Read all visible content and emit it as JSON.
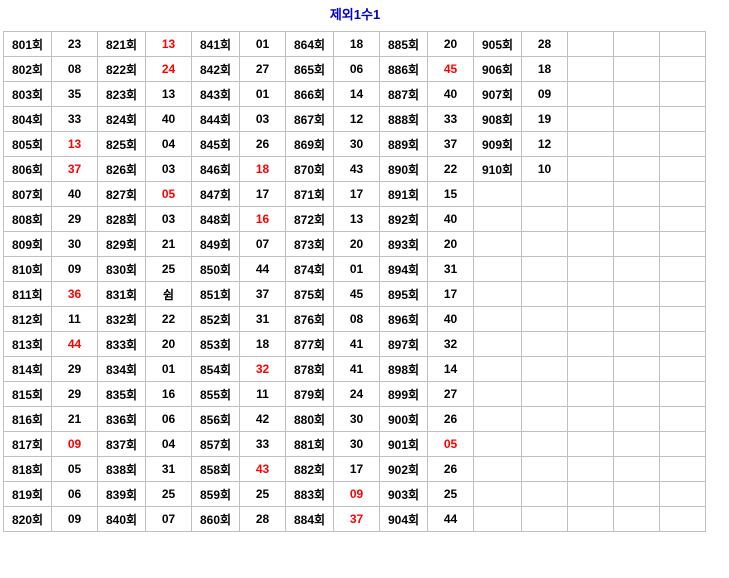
{
  "title": "제외1수1",
  "colors": {
    "title_blue": "#0000CC",
    "highlight_red": "#FF0000",
    "text_black": "#000000",
    "grid_line": "#C0C0C0",
    "background": "#FFFFFF"
  },
  "table": {
    "num_rows": 20,
    "empty_columns": 3,
    "groups": [
      {
        "rows": [
          {
            "label": "801회",
            "value": "23"
          },
          {
            "label": "802회",
            "value": "08"
          },
          {
            "label": "803회",
            "value": "35"
          },
          {
            "label": "804회",
            "value": "33"
          },
          {
            "label": "805회",
            "value": "13",
            "red": true
          },
          {
            "label": "806회",
            "value": "37",
            "red": true
          },
          {
            "label": "807회",
            "value": "40"
          },
          {
            "label": "808회",
            "value": "29"
          },
          {
            "label": "809회",
            "value": "30"
          },
          {
            "label": "810회",
            "value": "09"
          },
          {
            "label": "811회",
            "value": "36",
            "red": true
          },
          {
            "label": "812회",
            "value": "11"
          },
          {
            "label": "813회",
            "value": "44",
            "red": true
          },
          {
            "label": "814회",
            "value": "29"
          },
          {
            "label": "815회",
            "value": "29"
          },
          {
            "label": "816회",
            "value": "21"
          },
          {
            "label": "817회",
            "value": "09",
            "red": true
          },
          {
            "label": "818회",
            "value": "05"
          },
          {
            "label": "819회",
            "value": "06"
          },
          {
            "label": "820회",
            "value": "09"
          }
        ]
      },
      {
        "rows": [
          {
            "label": "821회",
            "value": "13",
            "red": true
          },
          {
            "label": "822회",
            "value": "24",
            "red": true
          },
          {
            "label": "823회",
            "value": "13"
          },
          {
            "label": "824회",
            "value": "40"
          },
          {
            "label": "825회",
            "value": "04"
          },
          {
            "label": "826회",
            "value": "03"
          },
          {
            "label": "827회",
            "value": "05",
            "red": true
          },
          {
            "label": "828회",
            "value": "03"
          },
          {
            "label": "829회",
            "value": "21"
          },
          {
            "label": "830회",
            "value": "25"
          },
          {
            "label": "831회",
            "value": "쉼"
          },
          {
            "label": "832회",
            "value": "22"
          },
          {
            "label": "833회",
            "value": "20"
          },
          {
            "label": "834회",
            "value": "01"
          },
          {
            "label": "835회",
            "value": "16"
          },
          {
            "label": "836회",
            "value": "06"
          },
          {
            "label": "837회",
            "value": "04"
          },
          {
            "label": "838회",
            "value": "31"
          },
          {
            "label": "839회",
            "value": "25"
          },
          {
            "label": "840회",
            "value": "07"
          }
        ]
      },
      {
        "rows": [
          {
            "label": "841회",
            "value": "01"
          },
          {
            "label": "842회",
            "value": "27"
          },
          {
            "label": "843회",
            "value": "01"
          },
          {
            "label": "844회",
            "value": "03"
          },
          {
            "label": "845회",
            "value": "26"
          },
          {
            "label": "846회",
            "value": "18",
            "red": true
          },
          {
            "label": "847회",
            "value": "17"
          },
          {
            "label": "848회",
            "value": "16",
            "red": true
          },
          {
            "label": "849회",
            "value": "07"
          },
          {
            "label": "850회",
            "value": "44"
          },
          {
            "label": "851회",
            "value": "37"
          },
          {
            "label": "852회",
            "value": "31"
          },
          {
            "label": "853회",
            "value": "18"
          },
          {
            "label": "854회",
            "value": "32",
            "red": true
          },
          {
            "label": "855회",
            "value": "11"
          },
          {
            "label": "856회",
            "value": "42"
          },
          {
            "label": "857회",
            "value": "33"
          },
          {
            "label": "858회",
            "value": "43",
            "red": true
          },
          {
            "label": "859회",
            "value": "25"
          },
          {
            "label": "860회",
            "value": "28"
          }
        ]
      },
      {
        "rows": [
          {
            "label": "864회",
            "value": "18"
          },
          {
            "label": "865회",
            "value": "06"
          },
          {
            "label": "866회",
            "value": "14"
          },
          {
            "label": "867회",
            "value": "12"
          },
          {
            "label": "869회",
            "value": "30"
          },
          {
            "label": "870회",
            "value": "43"
          },
          {
            "label": "871회",
            "value": "17"
          },
          {
            "label": "872회",
            "value": "13"
          },
          {
            "label": "873회",
            "value": "20"
          },
          {
            "label": "874회",
            "value": "01"
          },
          {
            "label": "875회",
            "value": "45"
          },
          {
            "label": "876회",
            "value": "08"
          },
          {
            "label": "877회",
            "value": "41"
          },
          {
            "label": "878회",
            "value": "41"
          },
          {
            "label": "879회",
            "value": "24"
          },
          {
            "label": "880회",
            "value": "30"
          },
          {
            "label": "881회",
            "value": "30"
          },
          {
            "label": "882회",
            "value": "17"
          },
          {
            "label": "883회",
            "value": "09",
            "red": true
          },
          {
            "label": "884회",
            "value": "37",
            "red": true
          }
        ]
      },
      {
        "rows": [
          {
            "label": "885회",
            "value": "20"
          },
          {
            "label": "886회",
            "value": "45",
            "red": true
          },
          {
            "label": "887회",
            "value": "40"
          },
          {
            "label": "888회",
            "value": "33"
          },
          {
            "label": "889회",
            "value": "37"
          },
          {
            "label": "890회",
            "value": "22"
          },
          {
            "label": "891회",
            "value": "15"
          },
          {
            "label": "892회",
            "value": "40"
          },
          {
            "label": "893회",
            "value": "20"
          },
          {
            "label": "894회",
            "value": "31"
          },
          {
            "label": "895회",
            "value": "17"
          },
          {
            "label": "896회",
            "value": "40"
          },
          {
            "label": "897회",
            "value": "32"
          },
          {
            "label": "898회",
            "value": "14"
          },
          {
            "label": "899회",
            "value": "27"
          },
          {
            "label": "900회",
            "value": "26"
          },
          {
            "label": "901회",
            "value": "05",
            "red": true
          },
          {
            "label": "902회",
            "value": "26"
          },
          {
            "label": "903회",
            "value": "25"
          },
          {
            "label": "904회",
            "value": "44"
          }
        ]
      },
      {
        "rows": [
          {
            "label": "905회",
            "value": "28"
          },
          {
            "label": "906회",
            "value": "18"
          },
          {
            "label": "907회",
            "value": "09"
          },
          {
            "label": "908회",
            "value": "19"
          },
          {
            "label": "909회",
            "value": "12"
          },
          {
            "label": "910회",
            "value": "10"
          }
        ]
      }
    ]
  }
}
